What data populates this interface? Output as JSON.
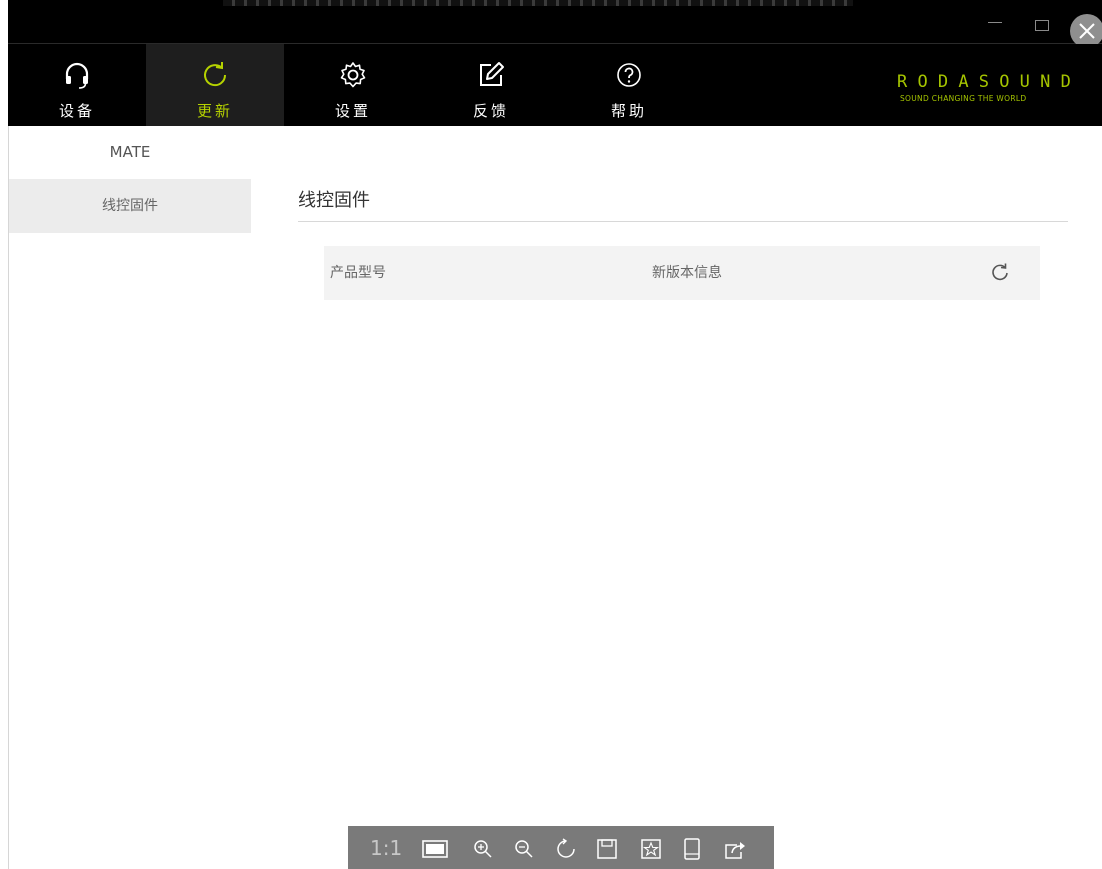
{
  "window": {
    "icons": [
      "minimize-icon",
      "maximize-icon",
      "close-icon"
    ]
  },
  "nav": {
    "items": [
      {
        "label": "设备",
        "icon": "headset-icon",
        "active": false
      },
      {
        "label": "更新",
        "icon": "refresh-icon",
        "active": true
      },
      {
        "label": "设置",
        "icon": "gear-icon",
        "active": false
      },
      {
        "label": "反馈",
        "icon": "edit-icon",
        "active": false
      },
      {
        "label": "帮助",
        "icon": "help-icon",
        "active": false
      }
    ],
    "accent": "#b5d200"
  },
  "brand": {
    "name": "RODASOUND",
    "tagline": "SOUND CHANGING THE WORLD",
    "color": "#a5c400"
  },
  "sidebar": {
    "header": "MATE",
    "items": [
      {
        "label": "线控固件"
      }
    ]
  },
  "main": {
    "title": "线控固件",
    "columns": [
      "产品型号",
      "新版本信息"
    ]
  },
  "viewer_toolbar": {
    "ratio_label": "1:1",
    "icons": [
      "fit-window-icon",
      "zoom-in-icon",
      "zoom-out-icon",
      "rotate-icon",
      "save-icon",
      "bookmark-icon",
      "tablet-icon",
      "share-icon"
    ]
  }
}
